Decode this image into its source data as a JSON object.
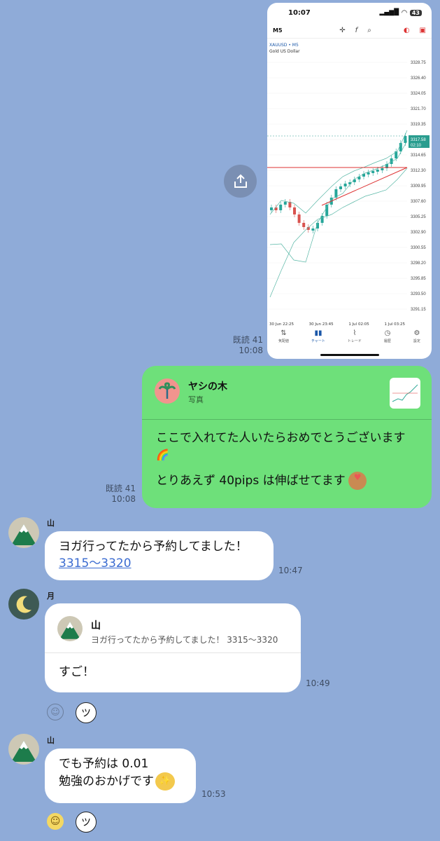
{
  "phone": {
    "time": "10:07",
    "battery": "43",
    "timeframe": "M5",
    "symbol": "XAUUSD • M5",
    "symbol_name": "Gold US Dollar",
    "prices": [
      "3328.75",
      "3326.40",
      "3324.05",
      "3321.70",
      "3319.35",
      "3317.58",
      "3314.65",
      "3312.30",
      "3309.95",
      "3307.60",
      "3305.25",
      "3302.90",
      "3300.55",
      "3298.20",
      "3295.85",
      "3293.50",
      "3291.15"
    ],
    "price_badge_time": "02:10",
    "xlabels": [
      "30 Jun 22:25",
      "30 Jun 23:45",
      "1 Jul 02:05",
      "1 Jul 03:25"
    ],
    "tabs": [
      "気配値",
      "チャート",
      "トレード",
      "履歴",
      "設定"
    ]
  },
  "msg1": {
    "read": "既読 41",
    "time": "10:08"
  },
  "msg2": {
    "reply_name": "ヤシの木",
    "reply_sub": "写真",
    "line1": "ここで入れてた人いたらおめでとうございます",
    "line2": "とりあえず 40pips は伸ばせてます",
    "read": "既読 41",
    "time": "10:08"
  },
  "msg3": {
    "sender": "山",
    "line1": "ヨガ行ってたから予約してました！",
    "link": "3315～3320",
    "time": "10:47"
  },
  "msg4": {
    "sender": "月",
    "quote_name": "山",
    "quote_text": "ヨガ行ってたから予約してました！ 3315～3320",
    "text": "すご！",
    "time": "10:49"
  },
  "msg5": {
    "sender": "山",
    "line1": "でも予約は 0.01",
    "line2": "勉強のおかげです",
    "time": "10:53"
  }
}
